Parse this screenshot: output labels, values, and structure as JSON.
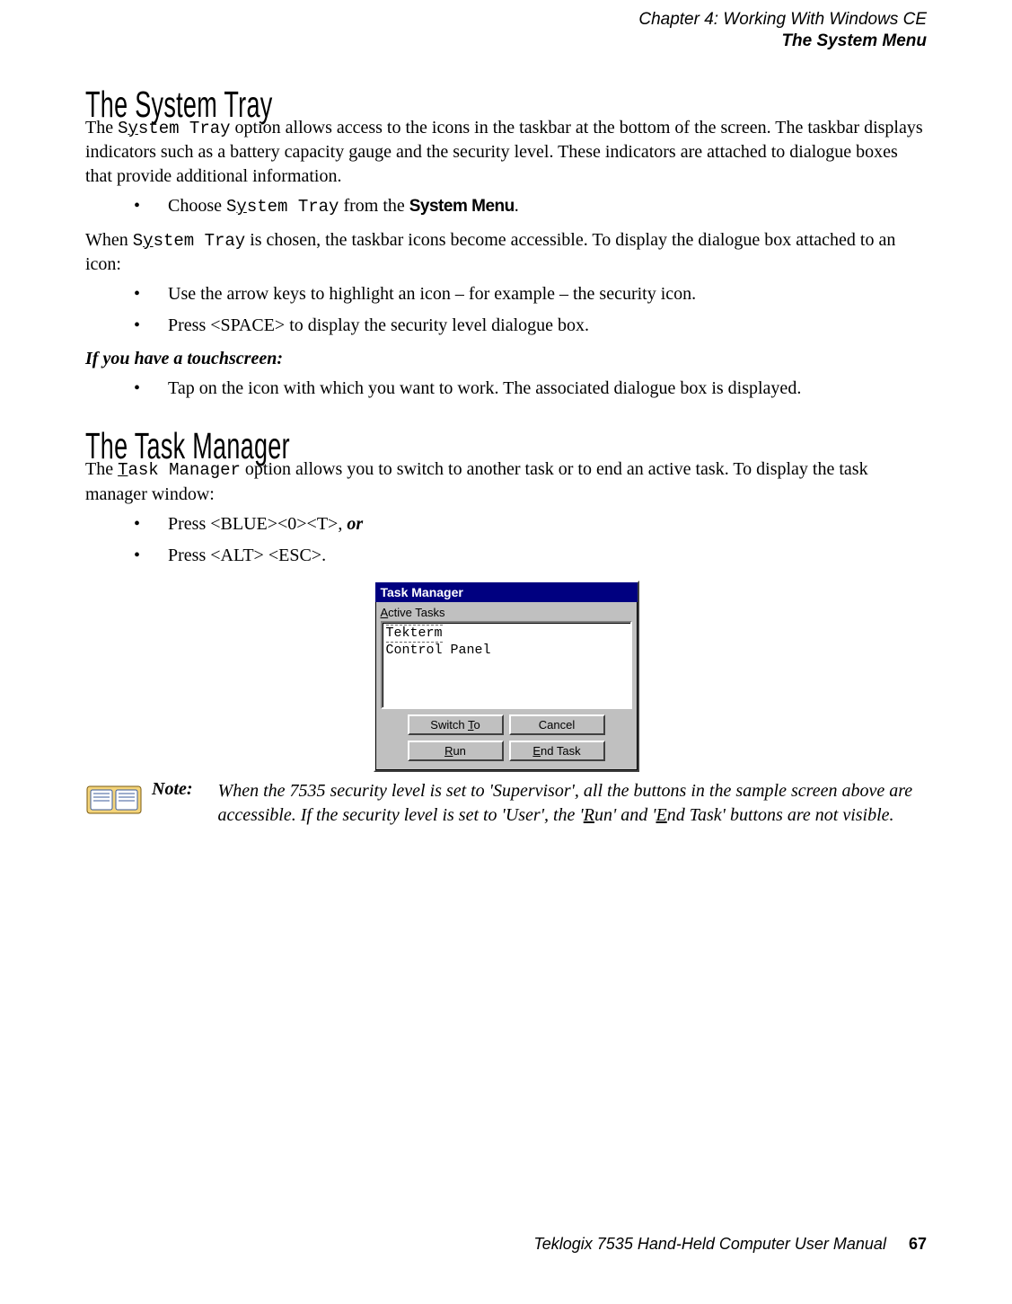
{
  "header": {
    "chapter": "Chapter 4: Working With Windows CE",
    "section": "The System Menu"
  },
  "systemTray": {
    "title": "The System Tray",
    "p1_pre": "The ",
    "p1_code": "System Tray",
    "p1_post": " option  allows access to the icons in the taskbar at the bottom of the screen. The taskbar displays indicators such as a battery capacity gauge and the security level. These indicators are attached to dialogue boxes that provide additional information.",
    "b1_pre": "Choose ",
    "b1_code": "System Tray",
    "b1_mid": " from the ",
    "b1_menu": "System Menu",
    "b1_post": ".",
    "p2_pre": "When ",
    "p2_code": "System Tray",
    "p2_post": " is chosen, the taskbar icons become accessible. To display the dialogue box attached to an icon:",
    "b2": "Use the arrow keys to highlight an icon – for example – the security icon.",
    "b3": "Press <SPACE> to display the security level dialogue box.",
    "touch_heading": "If you have a touchscreen:",
    "b4": "Tap on the icon with which you want to work. The associated dialogue box is displayed."
  },
  "taskManager": {
    "title": "The Task Manager",
    "p1_pre": "The ",
    "p1_code": "Task Manager",
    "p1_post": " option allows you to switch to another task or to end an active task. To display the task manager window:",
    "b1_pre": "Press <BLUE><0><T>, ",
    "b1_or": "or",
    "b2": "Press <ALT> <ESC>."
  },
  "tmWindow": {
    "title": "Task Manager",
    "label": "Active Tasks",
    "label_underline_index": 0,
    "items": [
      "Tekterm",
      "Control Panel"
    ],
    "buttons": {
      "switch": "Switch To",
      "cancel": "Cancel",
      "run": "Run",
      "end": "End Task"
    }
  },
  "note": {
    "label": "Note:",
    "text_pre": "When the 7535 security level is set to 'Supervisor', all the buttons in the sample screen above are accessible. If the security level is set to 'User', the '",
    "run_u": "R",
    "run_rest": "un' and '",
    "end_u": "E",
    "end_rest": "nd Task' buttons are not visible."
  },
  "footer": {
    "text": "Teklogix 7535 Hand-Held Computer User Manual",
    "page": "67"
  }
}
